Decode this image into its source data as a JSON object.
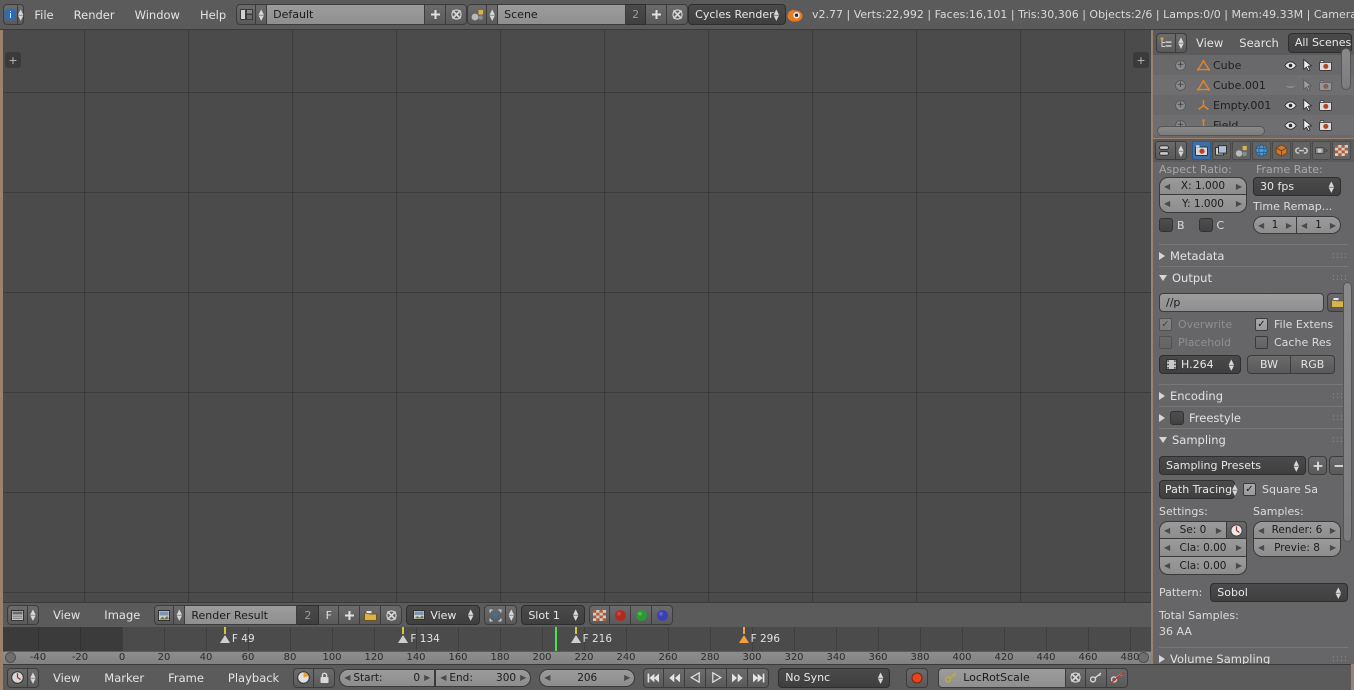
{
  "app": {
    "version_info": "v2.77 | Verts:22,992 | Faces:16,101 | Tris:30,306 | Objects:2/6 | Lamps:0/0 | Mem:49.33M | Camera"
  },
  "topbar": {
    "menus": [
      "File",
      "Render",
      "Window",
      "Help"
    ],
    "screen_layout": "Default",
    "scene_name": "Scene",
    "scene_users": "2",
    "render_engine": "Cycles Render"
  },
  "outliner": {
    "menus": [
      "View",
      "Search"
    ],
    "display_mode": "All Scenes",
    "rows": [
      {
        "name": "Cube",
        "visible": true,
        "selectable": true,
        "renderable": true
      },
      {
        "name": "Cube.001",
        "visible": false,
        "selectable": false,
        "renderable": false
      },
      {
        "name": "Empty.001",
        "visible": true,
        "selectable": true,
        "renderable": true
      },
      {
        "name": "Field",
        "visible": true,
        "selectable": true,
        "renderable": true
      }
    ]
  },
  "properties": {
    "tabs": [
      "render-tab",
      "render-layers-tab",
      "scene-tab",
      "world-tab",
      "object-tab",
      "constraints-tab",
      "physics-tab",
      "texture-tab"
    ],
    "active_tab": "render-tab",
    "dimensions": {
      "aspect_ratio_label": "Aspect Ratio:",
      "aspect_x": "X:  1.000",
      "aspect_y": "Y:  1.000",
      "border_label": "B",
      "crop_label": "C",
      "frame_rate_label": "Frame Rate:",
      "frame_rate": "30 fps",
      "time_remap_label": "Time Remap...",
      "remap_old": "1",
      "remap_new": "1"
    },
    "metadata_panel": "Metadata",
    "output_panel": "Output",
    "output": {
      "path": "//p",
      "overwrite_label": "Overwrite",
      "overwrite_checked": true,
      "file_extensions_label": "File Extens",
      "file_extensions_checked": true,
      "placeholders_label": "Placehold",
      "placeholders_checked": false,
      "cache_result_label": "Cache Res",
      "cache_result_checked": false,
      "format": "H.264",
      "bw_label": "BW",
      "rgb_label": "RGB"
    },
    "encoding_panel": "Encoding",
    "freestyle_panel": "Freestyle",
    "sampling_panel": "Sampling",
    "sampling": {
      "presets": "Sampling Presets",
      "add_label": "+",
      "remove_label": "–",
      "integrator": "Path Tracing",
      "square_samples_label": "Square Sa",
      "square_samples_checked": true,
      "settings_label": "Settings:",
      "samples_label": "Samples:",
      "seed": "Se:  0",
      "clamp_direct": "Cla:  0.00",
      "clamp_indirect": "Cla:  0.00",
      "render_samples": "Render: 6",
      "preview_samples": "Previe:  8",
      "pattern_label": "Pattern:",
      "pattern": "Sobol",
      "total_samples_label": "Total Samples:",
      "total_samples": "36 AA"
    },
    "volume_sampling_panel": "Volume Sampling"
  },
  "image_editor": {
    "menus": [
      "View",
      "Image"
    ],
    "image_name": "Render Result",
    "image_users": "2",
    "fake_user_label": "F",
    "view_mode": "View",
    "slot": "Slot 1",
    "channels": [
      "color-and-alpha-channel",
      "red-channel",
      "green-channel",
      "blue-channel"
    ]
  },
  "timeline": {
    "menus": [
      "View",
      "Marker",
      "Frame",
      "Playback"
    ],
    "start_label": "Start:",
    "start_value": "0",
    "end_label": "End:",
    "end_value": "300",
    "current_frame": "206",
    "sync_mode": "No Sync",
    "keying_set": "LocRotScale",
    "ticks": [
      {
        "label": "-40",
        "frame": -40
      },
      {
        "label": "-20",
        "frame": -20
      },
      {
        "label": "0",
        "frame": 0
      },
      {
        "label": "20",
        "frame": 20
      },
      {
        "label": "40",
        "frame": 40
      },
      {
        "label": "60",
        "frame": 60
      },
      {
        "label": "80",
        "frame": 80
      },
      {
        "label": "100",
        "frame": 100
      },
      {
        "label": "120",
        "frame": 120
      },
      {
        "label": "140",
        "frame": 140
      },
      {
        "label": "160",
        "frame": 160
      },
      {
        "label": "180",
        "frame": 180
      },
      {
        "label": "200",
        "frame": 200
      },
      {
        "label": "220",
        "frame": 220
      },
      {
        "label": "240",
        "frame": 240
      },
      {
        "label": "260",
        "frame": 260
      },
      {
        "label": "280",
        "frame": 280
      },
      {
        "label": "300",
        "frame": 300
      },
      {
        "label": "320",
        "frame": 320
      },
      {
        "label": "340",
        "frame": 340
      },
      {
        "label": "360",
        "frame": 360
      },
      {
        "label": "380",
        "frame": 380
      },
      {
        "label": "400",
        "frame": 400
      },
      {
        "label": "420",
        "frame": 420
      },
      {
        "label": "440",
        "frame": 440
      },
      {
        "label": "460",
        "frame": 460
      },
      {
        "label": "480",
        "frame": 480
      }
    ],
    "markers": [
      {
        "label": "F 49",
        "frame": 49,
        "selected": false
      },
      {
        "label": "F 134",
        "frame": 134,
        "selected": false
      },
      {
        "label": "F 216",
        "frame": 216,
        "selected": false
      },
      {
        "label": "F 296",
        "frame": 296,
        "selected": true
      }
    ]
  },
  "colors": {
    "window_bg": "#9b8270",
    "header_bg": "#5b5b5b",
    "editor_bg": "#4b4b4b",
    "panel_bg": "#666668",
    "accent_blue": "#3d6fa8",
    "playhead_green": "#4ee04e",
    "marker_selected": "#f3a03a",
    "record_red": "#e8451f"
  }
}
